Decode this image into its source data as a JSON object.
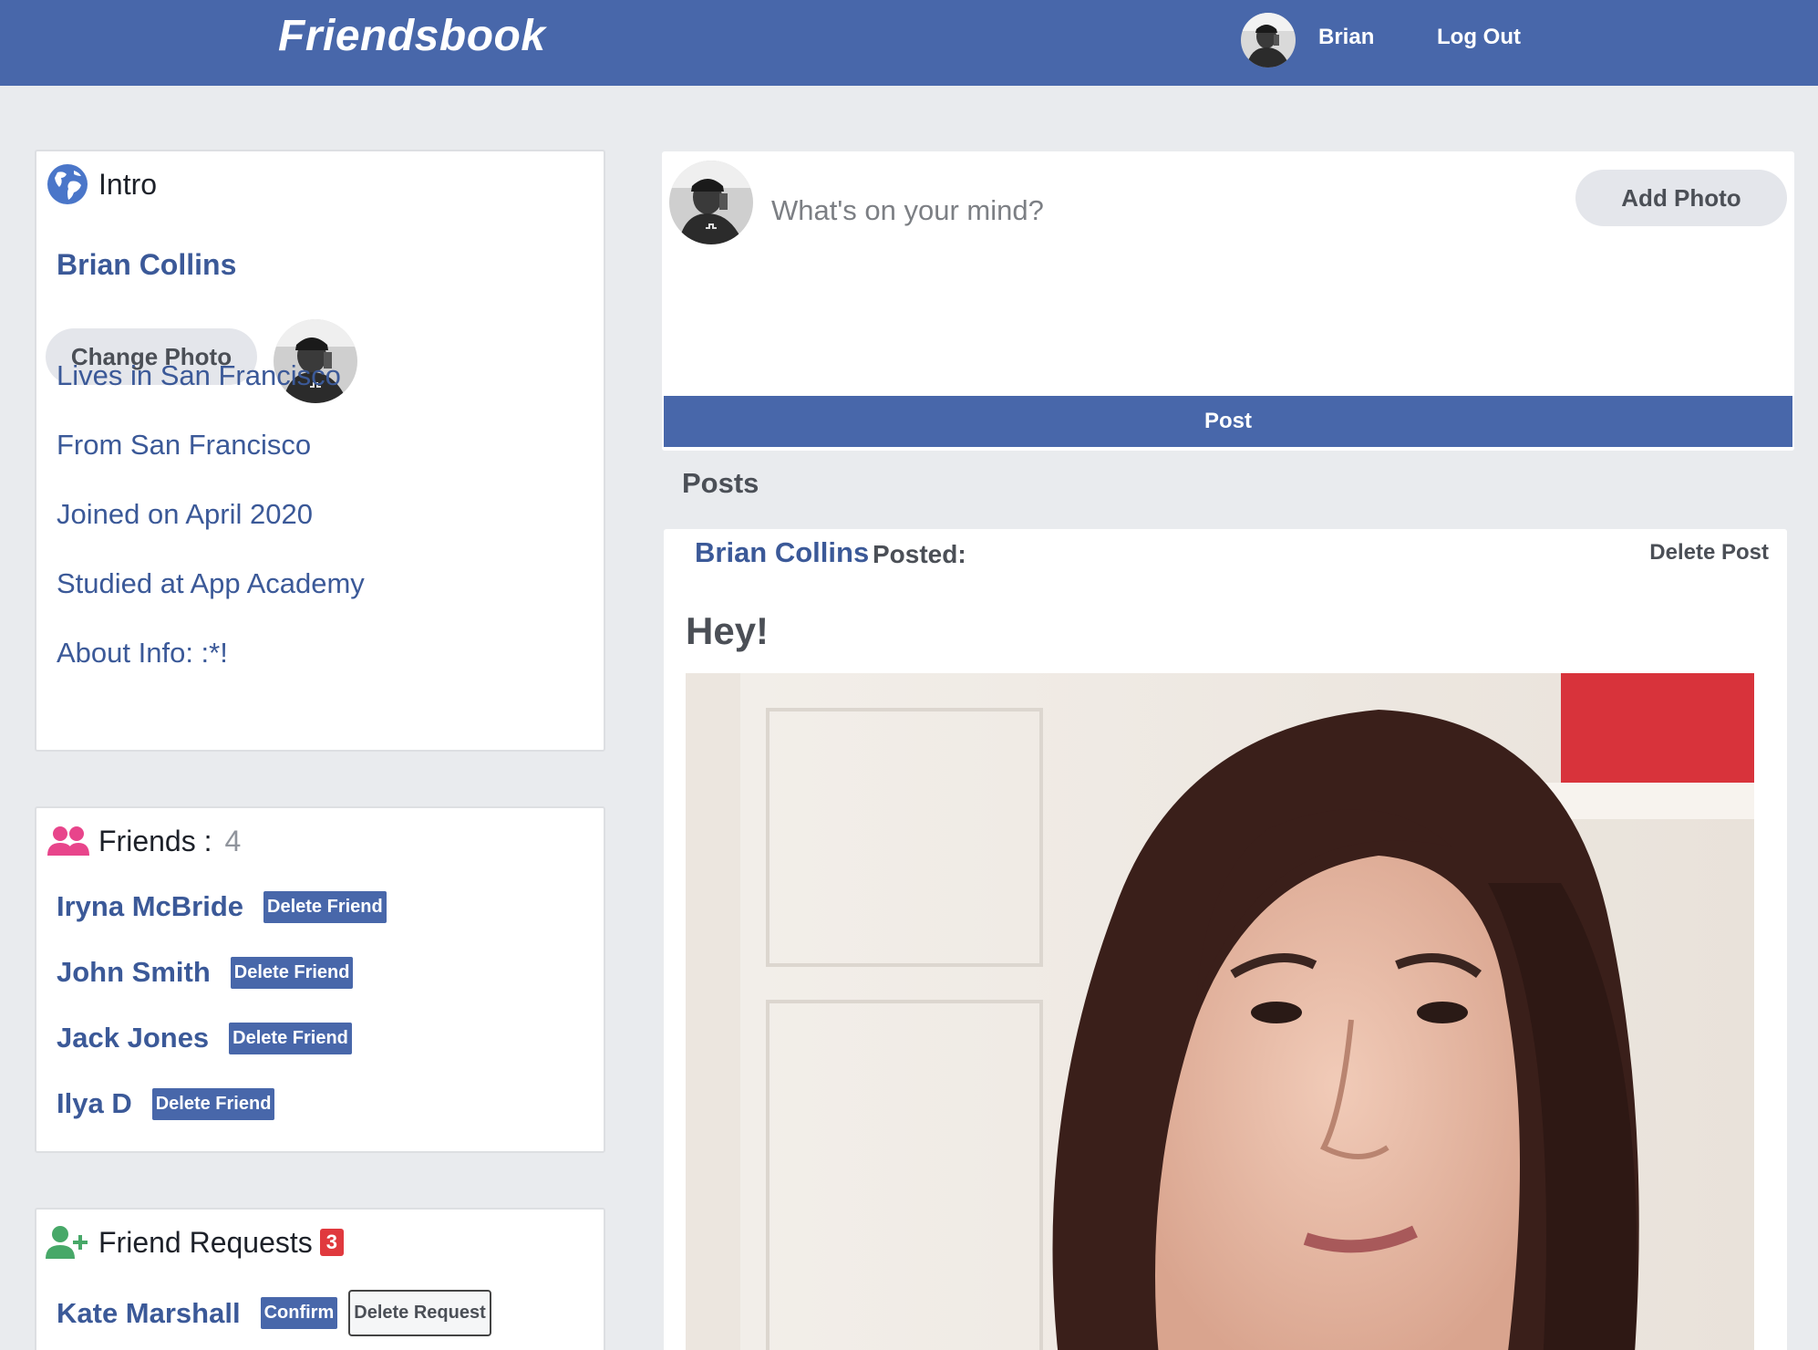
{
  "header": {
    "logo": "Friendsbook",
    "user_name": "Brian",
    "logout_label": "Log Out",
    "colors": {
      "brand": "#4867aa",
      "link": "#3b5998"
    }
  },
  "intro": {
    "title": "Intro",
    "icon": "globe-icon",
    "name": "Brian Collins",
    "change_photo_label": "Change Photo",
    "lives_in": "Lives in San Francisco",
    "from": "From San Francisco",
    "joined": "Joined on April 2020",
    "studied": "Studied at App Academy",
    "about": "About Info: :*!"
  },
  "friends": {
    "title": "Friends :",
    "count": "4",
    "icon": "users-icon",
    "items": [
      {
        "name": "Iryna McBride",
        "action": "Delete Friend"
      },
      {
        "name": "John Smith",
        "action": "Delete Friend"
      },
      {
        "name": "Jack Jones",
        "action": "Delete Friend"
      },
      {
        "name": "Ilya D",
        "action": "Delete Friend"
      }
    ]
  },
  "requests": {
    "title": "Friend Requests",
    "count": "3",
    "icon": "user-plus-icon",
    "items": [
      {
        "name": "Kate Marshall",
        "confirm": "Confirm",
        "delete": "Delete Request"
      }
    ]
  },
  "composer": {
    "placeholder": "What's on your mind?",
    "add_photo_label": "Add Photo",
    "post_label": "Post"
  },
  "posts": {
    "heading": "Posts",
    "items": [
      {
        "author": "Brian Collins",
        "verb": "Posted:",
        "delete_label": "Delete Post",
        "body": "Hey!"
      }
    ]
  }
}
